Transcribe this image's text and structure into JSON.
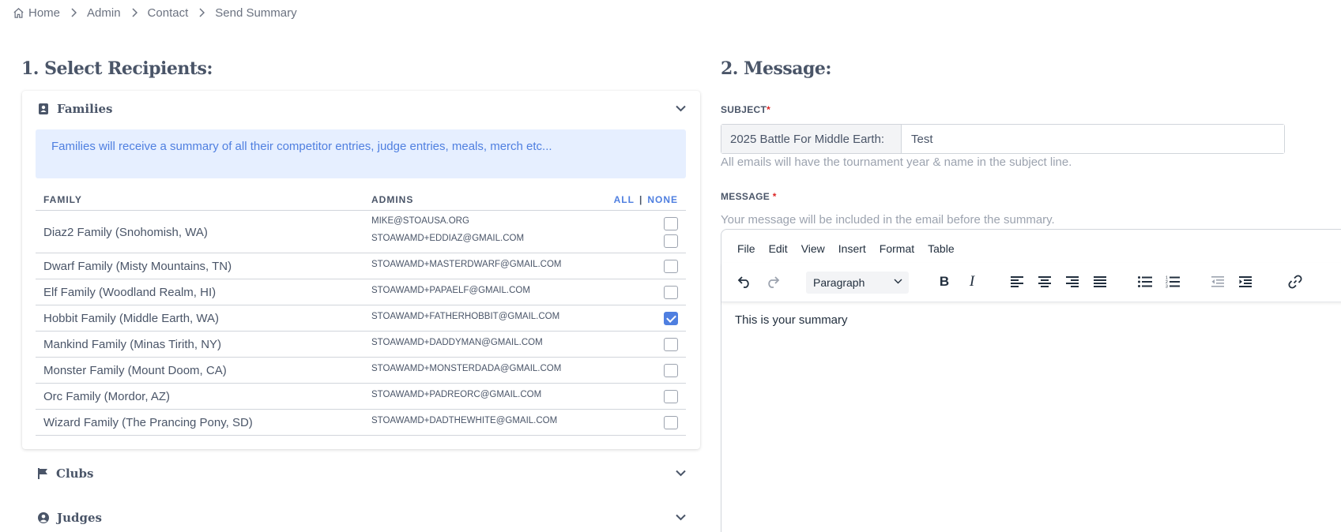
{
  "breadcrumb": [
    "Home",
    "Admin",
    "Contact",
    "Send Summary"
  ],
  "recipients": {
    "title": "1. Select Recipients:",
    "families": {
      "title": "Families",
      "info": "Families will receive a summary of all their competitor entries, judge entries, meals, merch etc...",
      "col_family": "FAMILY",
      "col_admins": "ADMINS",
      "all": "ALL",
      "separator": "|",
      "none": "NONE",
      "rows": [
        {
          "name": "Diaz2 Family (Snohomish, WA)",
          "emails": [
            "MIKE@STOAUSA.ORG",
            "STOAWAMD+EDDIAZ@GMAIL.COM"
          ],
          "checked": [
            false,
            false
          ]
        },
        {
          "name": "Dwarf Family (Misty Mountains, TN)",
          "emails": [
            "STOAWAMD+MASTERDWARF@GMAIL.COM"
          ],
          "checked": [
            false
          ]
        },
        {
          "name": "Elf Family (Woodland Realm, HI)",
          "emails": [
            "STOAWAMD+PAPAELF@GMAIL.COM"
          ],
          "checked": [
            false
          ]
        },
        {
          "name": "Hobbit Family (Middle Earth, WA)",
          "emails": [
            "STOAWAMD+FATHERHOBBIT@GMAIL.COM"
          ],
          "checked": [
            true
          ]
        },
        {
          "name": "Mankind Family (Minas Tirith, NY)",
          "emails": [
            "STOAWAMD+DADDYMAN@GMAIL.COM"
          ],
          "checked": [
            false
          ]
        },
        {
          "name": "Monster Family (Mount Doom, CA)",
          "emails": [
            "STOAWAMD+MONSTERDADA@GMAIL.COM"
          ],
          "checked": [
            false
          ]
        },
        {
          "name": "Orc Family (Mordor, AZ)",
          "emails": [
            "STOAWAMD+PADREORC@GMAIL.COM"
          ],
          "checked": [
            false
          ]
        },
        {
          "name": "Wizard Family (The Prancing Pony, SD)",
          "emails": [
            "STOAWAMD+DADTHEWHITE@GMAIL.COM"
          ],
          "checked": [
            false
          ]
        }
      ]
    },
    "clubs": {
      "title": "Clubs"
    },
    "judges": {
      "title": "Judges"
    }
  },
  "message": {
    "title": "2. Message:",
    "subject_label": "SUBJECT",
    "subject_required": "*",
    "subject_prefix": "2025 Battle For Middle Earth:",
    "subject_value": "Test",
    "subject_help": "All emails will have the tournament year & name in the subject line.",
    "message_label": "MESSAGE",
    "message_required": "*",
    "message_help": "Your message will be included in the email before the summary.",
    "editor": {
      "menu": [
        "File",
        "Edit",
        "View",
        "Insert",
        "Format",
        "Table"
      ],
      "format_select": "Paragraph",
      "body": "This is your summary"
    }
  },
  "colors": {
    "accent": "#4f7fe0",
    "info_bg": "#e6efff",
    "required": "#dc2626"
  }
}
